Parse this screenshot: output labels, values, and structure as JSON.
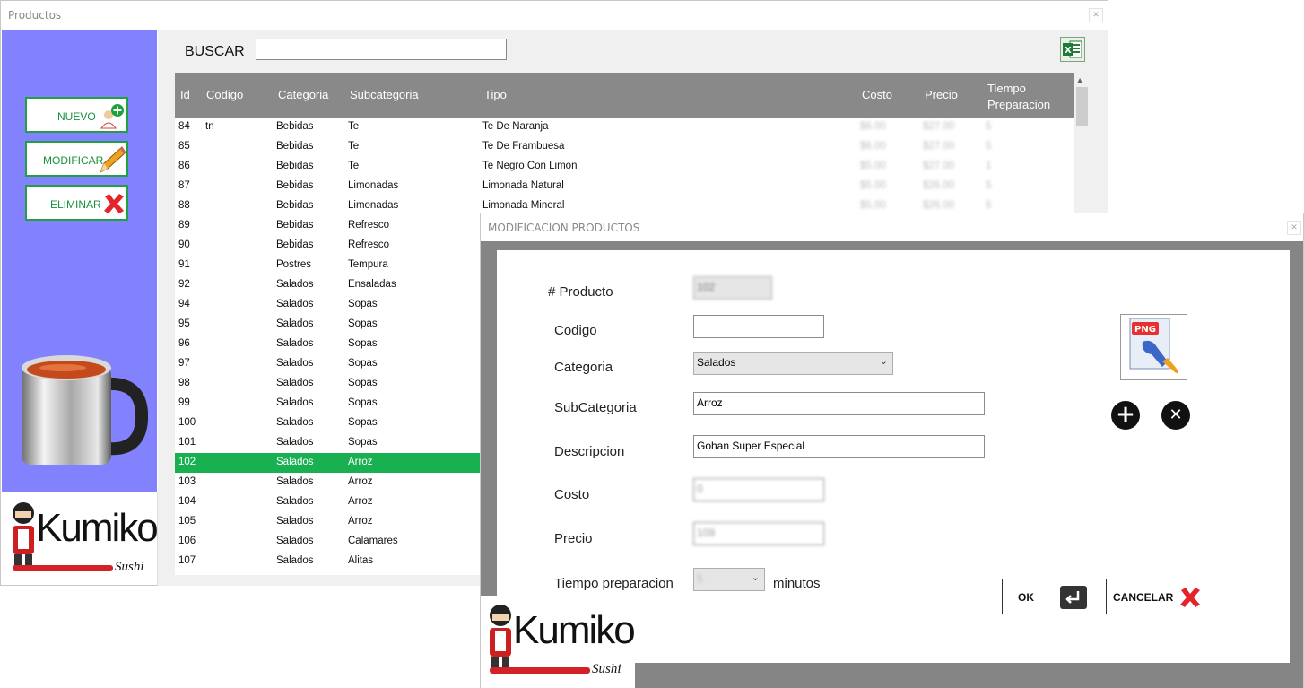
{
  "main_window": {
    "title": "Productos"
  },
  "sidebar": {
    "buttons": [
      {
        "label": "NUEVO"
      },
      {
        "label": "MODIFICAR"
      },
      {
        "label": "ELIMINAR"
      }
    ],
    "logo": {
      "brand": "Kumiko",
      "sub": "Sushi"
    }
  },
  "search": {
    "label": "BUSCAR",
    "value": ""
  },
  "grid": {
    "columns": [
      "Id",
      "Codigo",
      "Categoria",
      "Subcategoria",
      "Tipo",
      "Costo",
      "Precio",
      "Tiempo Preparacion"
    ],
    "rows": [
      {
        "id": "84",
        "codigo": "tn",
        "categoria": "Bebidas",
        "subcategoria": "Te",
        "tipo": "Te De Naranja",
        "costo": "$6.00",
        "precio": "$27.00",
        "tiempo": "5"
      },
      {
        "id": "85",
        "codigo": "",
        "categoria": "Bebidas",
        "subcategoria": "Te",
        "tipo": "Te De Frambuesa",
        "costo": "$6.00",
        "precio": "$27.00",
        "tiempo": "5"
      },
      {
        "id": "86",
        "codigo": "",
        "categoria": "Bebidas",
        "subcategoria": "Te",
        "tipo": "Te Negro Con Limon",
        "costo": "$5.00",
        "precio": "$27.00",
        "tiempo": "1"
      },
      {
        "id": "87",
        "codigo": "",
        "categoria": "Bebidas",
        "subcategoria": "Limonadas",
        "tipo": "Limonada Natural",
        "costo": "$5.00",
        "precio": "$26.00",
        "tiempo": "5"
      },
      {
        "id": "88",
        "codigo": "",
        "categoria": "Bebidas",
        "subcategoria": "Limonadas",
        "tipo": "Limonada Mineral",
        "costo": "$5.00",
        "precio": "$26.00",
        "tiempo": "5"
      },
      {
        "id": "89",
        "codigo": "",
        "categoria": "Bebidas",
        "subcategoria": "Refresco",
        "tipo": "",
        "costo": "",
        "precio": "",
        "tiempo": ""
      },
      {
        "id": "90",
        "codigo": "",
        "categoria": "Bebidas",
        "subcategoria": "Refresco",
        "tipo": "",
        "costo": "",
        "precio": "",
        "tiempo": ""
      },
      {
        "id": "91",
        "codigo": "",
        "categoria": "Postres",
        "subcategoria": "Tempura",
        "tipo": "",
        "costo": "",
        "precio": "",
        "tiempo": ""
      },
      {
        "id": "92",
        "codigo": "",
        "categoria": "Salados",
        "subcategoria": "Ensaladas",
        "tipo": "",
        "costo": "",
        "precio": "",
        "tiempo": ""
      },
      {
        "id": "94",
        "codigo": "",
        "categoria": "Salados",
        "subcategoria": "Sopas",
        "tipo": "",
        "costo": "",
        "precio": "",
        "tiempo": ""
      },
      {
        "id": "95",
        "codigo": "",
        "categoria": "Salados",
        "subcategoria": "Sopas",
        "tipo": "",
        "costo": "",
        "precio": "",
        "tiempo": ""
      },
      {
        "id": "96",
        "codigo": "",
        "categoria": "Salados",
        "subcategoria": "Sopas",
        "tipo": "",
        "costo": "",
        "precio": "",
        "tiempo": ""
      },
      {
        "id": "97",
        "codigo": "",
        "categoria": "Salados",
        "subcategoria": "Sopas",
        "tipo": "",
        "costo": "",
        "precio": "",
        "tiempo": ""
      },
      {
        "id": "98",
        "codigo": "",
        "categoria": "Salados",
        "subcategoria": "Sopas",
        "tipo": "",
        "costo": "",
        "precio": "",
        "tiempo": ""
      },
      {
        "id": "99",
        "codigo": "",
        "categoria": "Salados",
        "subcategoria": "Sopas",
        "tipo": "",
        "costo": "",
        "precio": "",
        "tiempo": ""
      },
      {
        "id": "100",
        "codigo": "",
        "categoria": "Salados",
        "subcategoria": "Sopas",
        "tipo": "",
        "costo": "",
        "precio": "",
        "tiempo": ""
      },
      {
        "id": "101",
        "codigo": "",
        "categoria": "Salados",
        "subcategoria": "Sopas",
        "tipo": "",
        "costo": "",
        "precio": "",
        "tiempo": ""
      },
      {
        "id": "102",
        "codigo": "",
        "categoria": "Salados",
        "subcategoria": "Arroz",
        "tipo": "",
        "costo": "",
        "precio": "",
        "tiempo": "",
        "selected": true
      },
      {
        "id": "103",
        "codigo": "",
        "categoria": "Salados",
        "subcategoria": "Arroz",
        "tipo": "",
        "costo": "",
        "precio": "",
        "tiempo": ""
      },
      {
        "id": "104",
        "codigo": "",
        "categoria": "Salados",
        "subcategoria": "Arroz",
        "tipo": "",
        "costo": "",
        "precio": "",
        "tiempo": ""
      },
      {
        "id": "105",
        "codigo": "",
        "categoria": "Salados",
        "subcategoria": "Arroz",
        "tipo": "",
        "costo": "",
        "precio": "",
        "tiempo": ""
      },
      {
        "id": "106",
        "codigo": "",
        "categoria": "Salados",
        "subcategoria": "Calamares",
        "tipo": "",
        "costo": "",
        "precio": "",
        "tiempo": ""
      },
      {
        "id": "107",
        "codigo": "",
        "categoria": "Salados",
        "subcategoria": "Alitas",
        "tipo": "",
        "costo": "",
        "precio": "",
        "tiempo": ""
      }
    ]
  },
  "dialog": {
    "title": "MODIFICACION PRODUCTOS",
    "fields": {
      "producto": {
        "label": "# Producto",
        "value": "102"
      },
      "codigo": {
        "label": "Codigo",
        "value": ""
      },
      "categoria": {
        "label": "Categoria",
        "value": "Salados"
      },
      "subcategoria": {
        "label": "SubCategoria",
        "value": "Arroz"
      },
      "descripcion": {
        "label": "Descripcion",
        "value": "Gohan Super Especial"
      },
      "costo": {
        "label": "Costo",
        "value": "0"
      },
      "precio": {
        "label": "Precio",
        "value": "109"
      },
      "tiempo": {
        "label": "Tiempo preparacion",
        "value": "5",
        "suffix": "minutos"
      }
    },
    "image_badge": "PNG",
    "ok_label": "OK",
    "cancel_label": "CANCELAR",
    "logo": {
      "brand": "Kumiko",
      "sub": "Sushi"
    }
  },
  "colors": {
    "sidebar": "#8282ff",
    "selected_row": "#19b052",
    "header": "#898989",
    "button_border": "#20a040"
  }
}
